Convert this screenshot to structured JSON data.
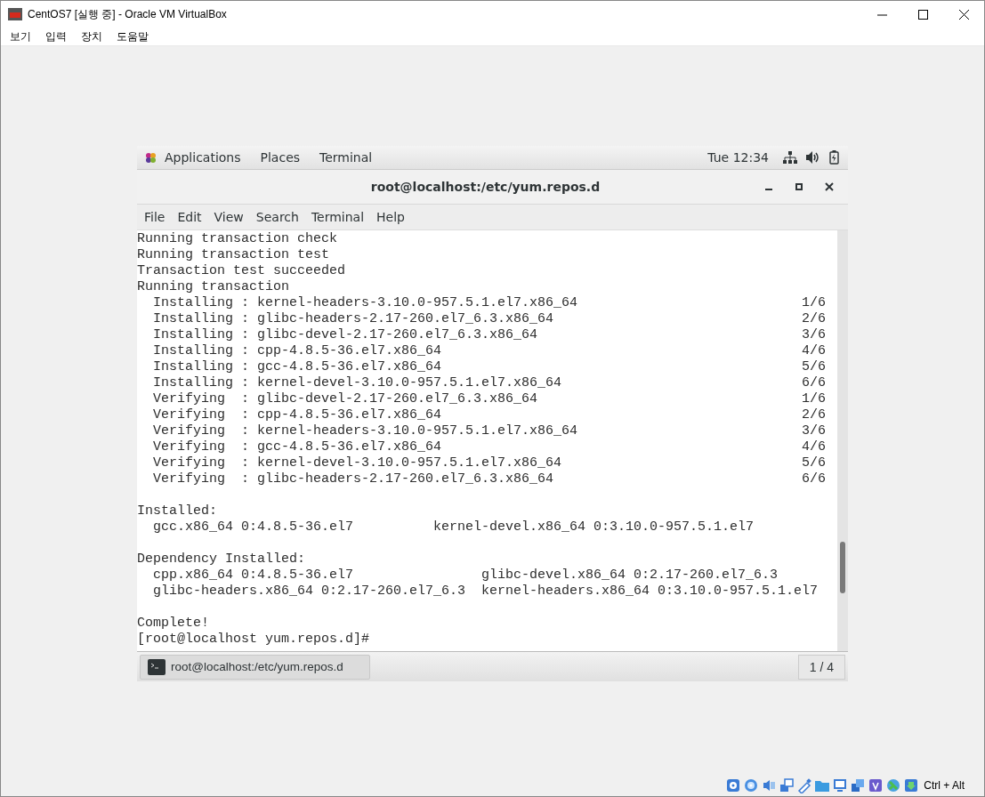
{
  "window": {
    "title": "CentOS7 [실행 중] - Oracle VM VirtualBox"
  },
  "menu": [
    "보기",
    "입력",
    "장치",
    "도움말"
  ],
  "guest": {
    "top_bar": {
      "items": [
        "Applications",
        "Places",
        "Terminal"
      ],
      "clock": "Tue 12:34"
    },
    "terminal": {
      "title": "root@localhost:/etc/yum.repos.d",
      "menu": [
        "File",
        "Edit",
        "View",
        "Search",
        "Terminal",
        "Help"
      ],
      "lines": [
        {
          "kind": "line",
          "text": "Running transaction check"
        },
        {
          "kind": "line",
          "text": "Running transaction test"
        },
        {
          "kind": "line",
          "text": "Transaction test succeeded"
        },
        {
          "kind": "line",
          "text": "Running transaction"
        },
        {
          "kind": "line",
          "text": "  Installing : kernel-headers-3.10.0-957.5.1.el7.x86_64",
          "count": "1/6"
        },
        {
          "kind": "line",
          "text": "  Installing : glibc-headers-2.17-260.el7_6.3.x86_64",
          "count": "2/6"
        },
        {
          "kind": "line",
          "text": "  Installing : glibc-devel-2.17-260.el7_6.3.x86_64",
          "count": "3/6"
        },
        {
          "kind": "line",
          "text": "  Installing : cpp-4.8.5-36.el7.x86_64",
          "count": "4/6"
        },
        {
          "kind": "line",
          "text": "  Installing : gcc-4.8.5-36.el7.x86_64",
          "count": "5/6"
        },
        {
          "kind": "line",
          "text": "  Installing : kernel-devel-3.10.0-957.5.1.el7.x86_64",
          "count": "6/6"
        },
        {
          "kind": "line",
          "text": "  Verifying  : glibc-devel-2.17-260.el7_6.3.x86_64",
          "count": "1/6"
        },
        {
          "kind": "line",
          "text": "  Verifying  : cpp-4.8.5-36.el7.x86_64",
          "count": "2/6"
        },
        {
          "kind": "line",
          "text": "  Verifying  : kernel-headers-3.10.0-957.5.1.el7.x86_64",
          "count": "3/6"
        },
        {
          "kind": "line",
          "text": "  Verifying  : gcc-4.8.5-36.el7.x86_64",
          "count": "4/6"
        },
        {
          "kind": "line",
          "text": "  Verifying  : kernel-devel-3.10.0-957.5.1.el7.x86_64",
          "count": "5/6"
        },
        {
          "kind": "line",
          "text": "  Verifying  : glibc-headers-2.17-260.el7_6.3.x86_64",
          "count": "6/6"
        },
        {
          "kind": "blank"
        },
        {
          "kind": "line",
          "text": "Installed:"
        },
        {
          "kind": "line",
          "text": "  gcc.x86_64 0:4.8.5-36.el7          kernel-devel.x86_64 0:3.10.0-957.5.1.el7"
        },
        {
          "kind": "blank"
        },
        {
          "kind": "line",
          "text": "Dependency Installed:"
        },
        {
          "kind": "line",
          "text": "  cpp.x86_64 0:4.8.5-36.el7                glibc-devel.x86_64 0:2.17-260.el7_6.3"
        },
        {
          "kind": "line",
          "text": "  glibc-headers.x86_64 0:2.17-260.el7_6.3  kernel-headers.x86_64 0:3.10.0-957.5.1.el7"
        },
        {
          "kind": "blank"
        },
        {
          "kind": "line",
          "text": "Complete!"
        },
        {
          "kind": "line",
          "text": "[root@localhost yum.repos.d]#"
        }
      ]
    },
    "taskbar": {
      "task": "root@localhost:/etc/yum.repos.d",
      "workspace": "1 / 4"
    }
  },
  "status_bar": {
    "host_key": "Ctrl + Alt"
  }
}
